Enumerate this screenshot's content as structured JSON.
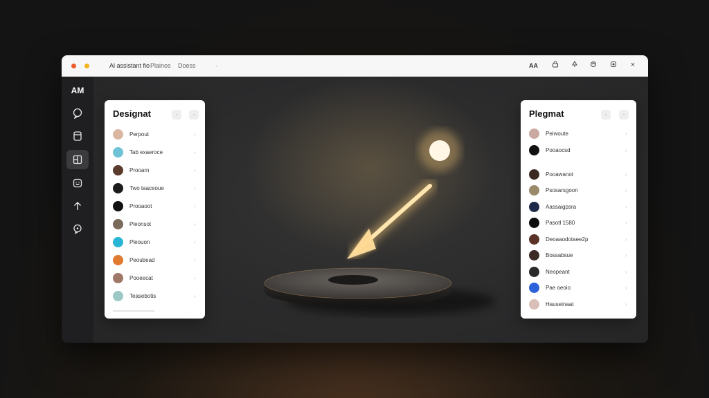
{
  "titlebar": {
    "title": "Al assistant fio",
    "menu_1": "Plainos",
    "menu_2": "Doess",
    "menu_3": "·",
    "right_label": "AA",
    "icons": [
      "lock-icon",
      "nav-arrow-icon",
      "refresh-icon",
      "settings-icon"
    ],
    "close": "×"
  },
  "sidebar": {
    "logo": "AM",
    "icons": [
      "chat-bubble-icon",
      "file-icon",
      "layout-icon",
      "smile-icon",
      "upload-arrow-icon",
      "feedback-icon"
    ]
  },
  "left_panel": {
    "title": "Designat",
    "items": [
      {
        "label": "Perpout",
        "avatar_color": "#d9b7a0"
      },
      {
        "label": "Tab exaeroce",
        "avatar_color": "#6fc3d6"
      },
      {
        "label": "Prooarn",
        "avatar_color": "#5a3b2c"
      },
      {
        "label": "Two taaceoue",
        "avatar_color": "#1c1c1c"
      },
      {
        "label": "Prooaoot",
        "avatar_color": "#111111"
      },
      {
        "label": "Pleonsot",
        "avatar_color": "#7a6a5c"
      },
      {
        "label": "Pleouon",
        "avatar_color": "#29b6d6"
      },
      {
        "label": "Peoubead",
        "avatar_color": "#e07a30"
      },
      {
        "label": "Pooeecat",
        "avatar_color": "#a07868"
      },
      {
        "label": "Teasebotis",
        "avatar_color": "#9cc8c8"
      }
    ]
  },
  "right_panel": {
    "title": "Plegmat",
    "items": [
      {
        "label": "Peiwoute",
        "avatar_color": "#c9a9a0"
      },
      {
        "label": "Pooaocsd",
        "avatar_color": "#111111"
      },
      {
        "label": "Pooawanot",
        "avatar_color": "#3a2a22"
      },
      {
        "label": "Psosarsgoon",
        "avatar_color": "#9a8a6a"
      },
      {
        "label": "Aassaigpsra",
        "avatar_color": "#1e2a4a"
      },
      {
        "label": "Pasotl 1580",
        "avatar_color": "#0c0c0c"
      },
      {
        "label": "Deoaaodotaee2p",
        "avatar_color": "#5a3228"
      },
      {
        "label": "Bossabsue",
        "avatar_color": "#3c2a24"
      },
      {
        "label": "Neopeant",
        "avatar_color": "#2a2a2a"
      },
      {
        "label": "Pae oeoio",
        "avatar_color": "#2b62d9"
      },
      {
        "label": "Hauseinaat",
        "avatar_color": "#d8c0b8"
      }
    ]
  },
  "colors": {
    "accent_glow": "#ffcf7a",
    "arrow": "#ffe6b0",
    "window_bg": "#2a2a2c"
  }
}
